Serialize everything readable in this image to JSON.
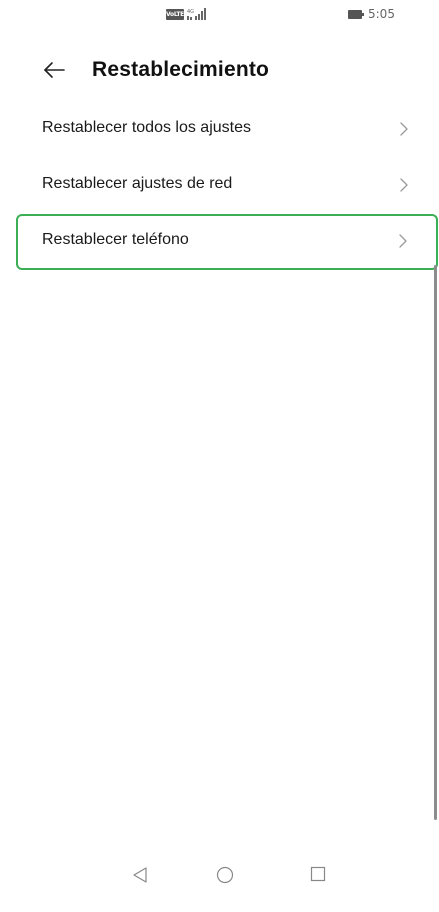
{
  "status_bar": {
    "volte_badge": "VoLTE",
    "time": "5:05",
    "icons": [
      "volte-icon",
      "signal-icon",
      "battery-icon"
    ]
  },
  "header": {
    "title": "Restablecimiento",
    "back_icon": "arrow-left-icon"
  },
  "menu": {
    "items": [
      {
        "label": "Restablecer todos los ajustes",
        "highlighted": false
      },
      {
        "label": "Restablecer ajustes de red",
        "highlighted": false
      },
      {
        "label": "Restablecer teléfono",
        "highlighted": true
      }
    ],
    "chevron_icon": "chevron-right-icon"
  },
  "nav_bar": {
    "icons": [
      "nav-back-icon",
      "nav-home-icon",
      "nav-recents-icon"
    ]
  },
  "colors": {
    "highlight": "#3cae55",
    "text": "#1a1a1a",
    "chevron": "#9a9a9a",
    "background": "#ffffff"
  }
}
